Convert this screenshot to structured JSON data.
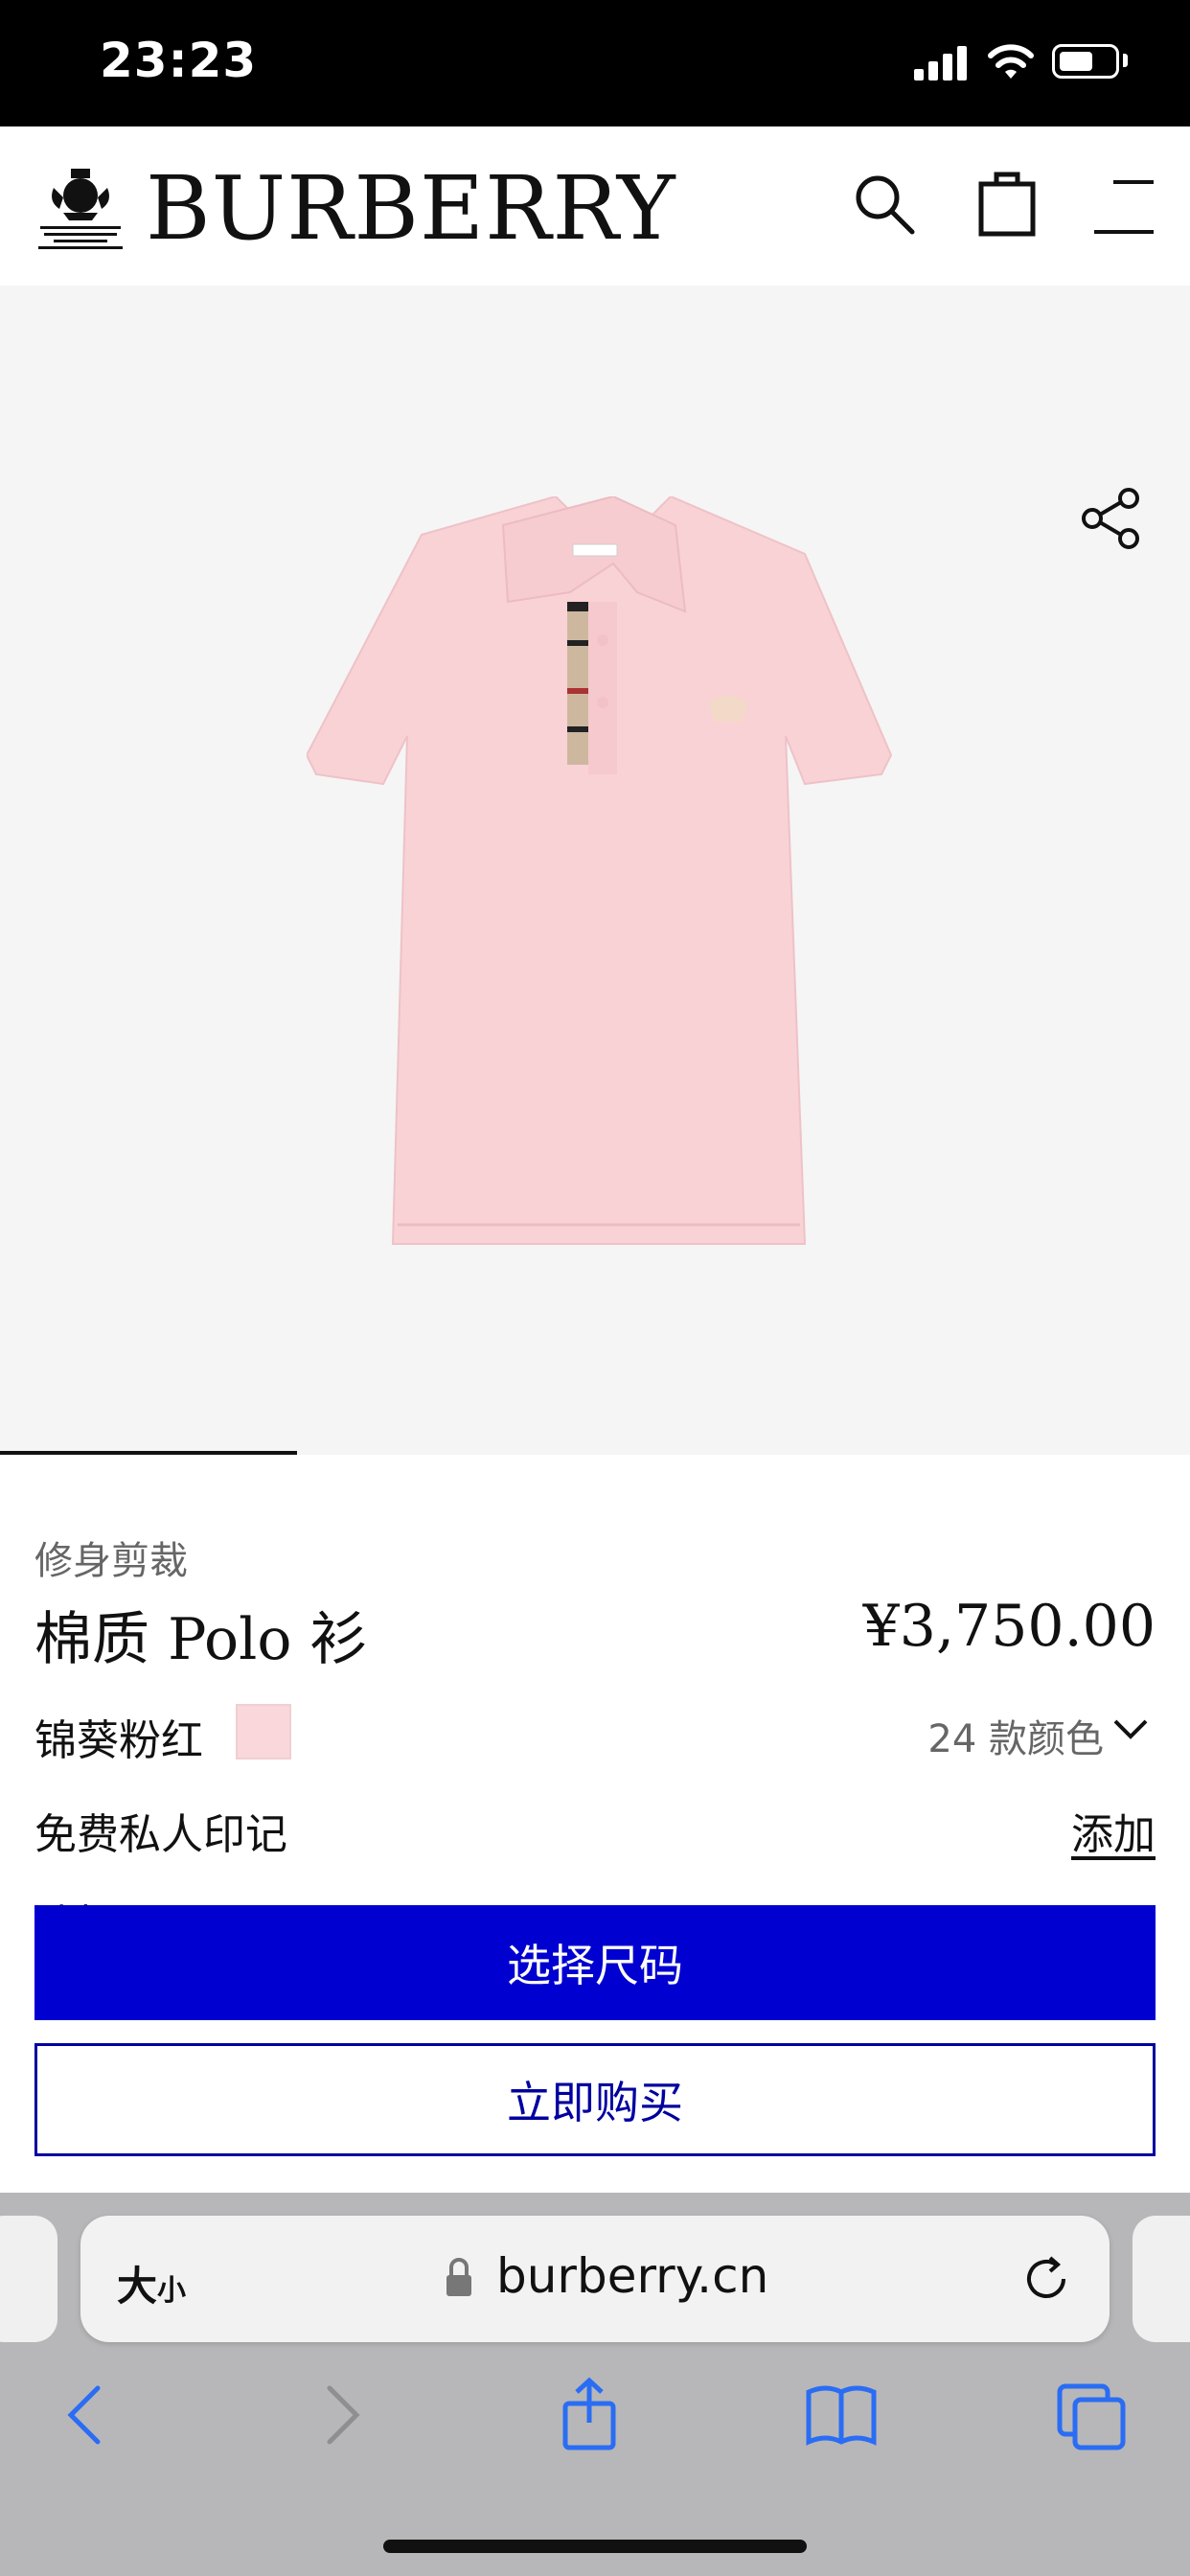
{
  "status_bar": {
    "time": "23:23"
  },
  "header": {
    "brand": "BURBERRY"
  },
  "product": {
    "fit": "修身剪裁",
    "title": "棉质 Polo 衫",
    "price": "¥3,750.00",
    "color_name": "锦葵粉红",
    "swatch_color": "#f9d7db",
    "colors_count": "24 款颜色",
    "monogram_label": "免费私人印记",
    "monogram_action": "添加",
    "partially_hidden_label": "选择尺码"
  },
  "actions": {
    "select_size": "选择尺码",
    "buy_now": "立即购买"
  },
  "browser": {
    "text_size_big": "大",
    "text_size_small": "小",
    "url": "burberry.cn"
  },
  "colors": {
    "primary_blue": "#0000d0",
    "hero_bg": "#f5f5f5",
    "swatch": "#f9d7db"
  },
  "icons": [
    "signal-icon",
    "wifi-icon",
    "battery-icon",
    "crest-logo",
    "search-icon",
    "bag-icon",
    "menu-icon",
    "share-icon",
    "chevron-down-icon",
    "lock-icon",
    "reload-icon",
    "back-icon",
    "forward-icon",
    "share-icon",
    "bookmarks-icon",
    "tabs-icon"
  ]
}
